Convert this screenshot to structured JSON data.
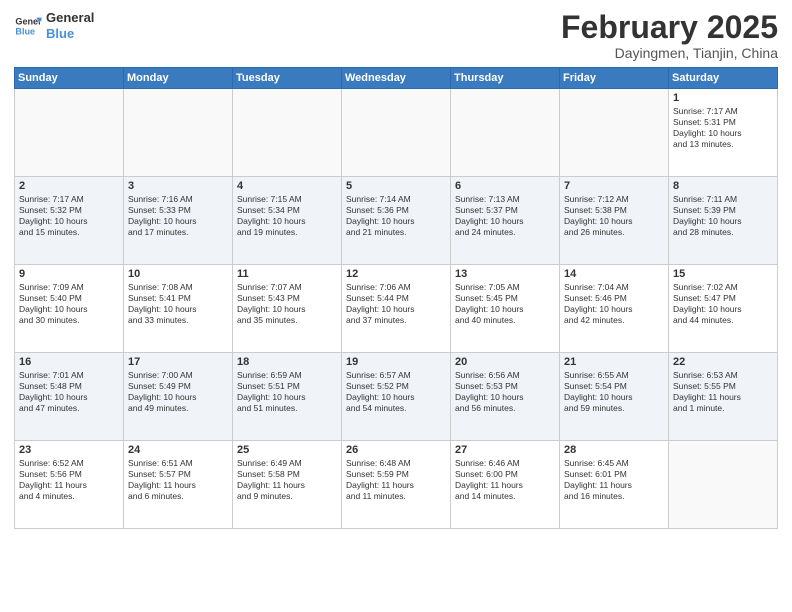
{
  "logo": {
    "line1": "General",
    "line2": "Blue"
  },
  "title": "February 2025",
  "subtitle": "Dayingmen, Tianjin, China",
  "weekdays": [
    "Sunday",
    "Monday",
    "Tuesday",
    "Wednesday",
    "Thursday",
    "Friday",
    "Saturday"
  ],
  "weeks": [
    [
      {
        "day": "",
        "info": ""
      },
      {
        "day": "",
        "info": ""
      },
      {
        "day": "",
        "info": ""
      },
      {
        "day": "",
        "info": ""
      },
      {
        "day": "",
        "info": ""
      },
      {
        "day": "",
        "info": ""
      },
      {
        "day": "1",
        "info": "Sunrise: 7:17 AM\nSunset: 5:31 PM\nDaylight: 10 hours\nand 13 minutes."
      }
    ],
    [
      {
        "day": "2",
        "info": "Sunrise: 7:17 AM\nSunset: 5:32 PM\nDaylight: 10 hours\nand 15 minutes."
      },
      {
        "day": "3",
        "info": "Sunrise: 7:16 AM\nSunset: 5:33 PM\nDaylight: 10 hours\nand 17 minutes."
      },
      {
        "day": "4",
        "info": "Sunrise: 7:15 AM\nSunset: 5:34 PM\nDaylight: 10 hours\nand 19 minutes."
      },
      {
        "day": "5",
        "info": "Sunrise: 7:14 AM\nSunset: 5:36 PM\nDaylight: 10 hours\nand 21 minutes."
      },
      {
        "day": "6",
        "info": "Sunrise: 7:13 AM\nSunset: 5:37 PM\nDaylight: 10 hours\nand 24 minutes."
      },
      {
        "day": "7",
        "info": "Sunrise: 7:12 AM\nSunset: 5:38 PM\nDaylight: 10 hours\nand 26 minutes."
      },
      {
        "day": "8",
        "info": "Sunrise: 7:11 AM\nSunset: 5:39 PM\nDaylight: 10 hours\nand 28 minutes."
      }
    ],
    [
      {
        "day": "9",
        "info": "Sunrise: 7:09 AM\nSunset: 5:40 PM\nDaylight: 10 hours\nand 30 minutes."
      },
      {
        "day": "10",
        "info": "Sunrise: 7:08 AM\nSunset: 5:41 PM\nDaylight: 10 hours\nand 33 minutes."
      },
      {
        "day": "11",
        "info": "Sunrise: 7:07 AM\nSunset: 5:43 PM\nDaylight: 10 hours\nand 35 minutes."
      },
      {
        "day": "12",
        "info": "Sunrise: 7:06 AM\nSunset: 5:44 PM\nDaylight: 10 hours\nand 37 minutes."
      },
      {
        "day": "13",
        "info": "Sunrise: 7:05 AM\nSunset: 5:45 PM\nDaylight: 10 hours\nand 40 minutes."
      },
      {
        "day": "14",
        "info": "Sunrise: 7:04 AM\nSunset: 5:46 PM\nDaylight: 10 hours\nand 42 minutes."
      },
      {
        "day": "15",
        "info": "Sunrise: 7:02 AM\nSunset: 5:47 PM\nDaylight: 10 hours\nand 44 minutes."
      }
    ],
    [
      {
        "day": "16",
        "info": "Sunrise: 7:01 AM\nSunset: 5:48 PM\nDaylight: 10 hours\nand 47 minutes."
      },
      {
        "day": "17",
        "info": "Sunrise: 7:00 AM\nSunset: 5:49 PM\nDaylight: 10 hours\nand 49 minutes."
      },
      {
        "day": "18",
        "info": "Sunrise: 6:59 AM\nSunset: 5:51 PM\nDaylight: 10 hours\nand 51 minutes."
      },
      {
        "day": "19",
        "info": "Sunrise: 6:57 AM\nSunset: 5:52 PM\nDaylight: 10 hours\nand 54 minutes."
      },
      {
        "day": "20",
        "info": "Sunrise: 6:56 AM\nSunset: 5:53 PM\nDaylight: 10 hours\nand 56 minutes."
      },
      {
        "day": "21",
        "info": "Sunrise: 6:55 AM\nSunset: 5:54 PM\nDaylight: 10 hours\nand 59 minutes."
      },
      {
        "day": "22",
        "info": "Sunrise: 6:53 AM\nSunset: 5:55 PM\nDaylight: 11 hours\nand 1 minute."
      }
    ],
    [
      {
        "day": "23",
        "info": "Sunrise: 6:52 AM\nSunset: 5:56 PM\nDaylight: 11 hours\nand 4 minutes."
      },
      {
        "day": "24",
        "info": "Sunrise: 6:51 AM\nSunset: 5:57 PM\nDaylight: 11 hours\nand 6 minutes."
      },
      {
        "day": "25",
        "info": "Sunrise: 6:49 AM\nSunset: 5:58 PM\nDaylight: 11 hours\nand 9 minutes."
      },
      {
        "day": "26",
        "info": "Sunrise: 6:48 AM\nSunset: 5:59 PM\nDaylight: 11 hours\nand 11 minutes."
      },
      {
        "day": "27",
        "info": "Sunrise: 6:46 AM\nSunset: 6:00 PM\nDaylight: 11 hours\nand 14 minutes."
      },
      {
        "day": "28",
        "info": "Sunrise: 6:45 AM\nSunset: 6:01 PM\nDaylight: 11 hours\nand 16 minutes."
      },
      {
        "day": "",
        "info": ""
      }
    ]
  ]
}
